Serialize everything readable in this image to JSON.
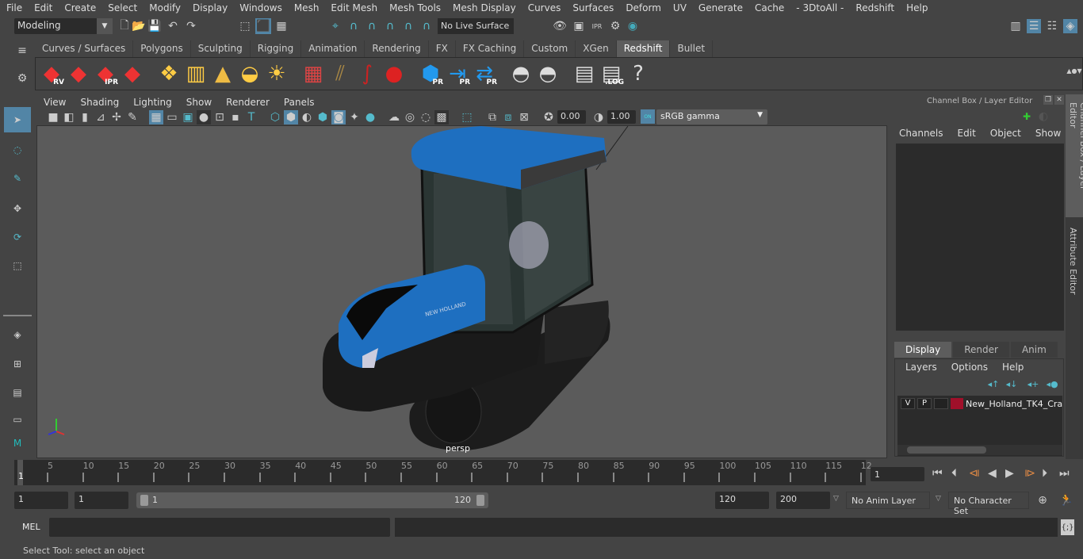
{
  "menu": [
    "File",
    "Edit",
    "Create",
    "Select",
    "Modify",
    "Display",
    "Windows",
    "Mesh",
    "Edit Mesh",
    "Mesh Tools",
    "Mesh Display",
    "Curves",
    "Surfaces",
    "Deform",
    "UV",
    "Generate",
    "Cache",
    "- 3DtoAll -",
    "Redshift",
    "Help"
  ],
  "mode": "Modeling",
  "live_surface": "No Live Surface",
  "shelf_tabs": [
    "Curves / Surfaces",
    "Polygons",
    "Sculpting",
    "Rigging",
    "Animation",
    "Rendering",
    "FX",
    "FX Caching",
    "Custom",
    "XGen",
    "Redshift",
    "Bullet"
  ],
  "active_shelf_tab": "Redshift",
  "shelf_icons": [
    {
      "name": "rv-icon",
      "label": "RV"
    },
    {
      "name": "render-clapper-icon",
      "label": ""
    },
    {
      "name": "ipr-icon",
      "label": "IPR"
    },
    {
      "name": "render-settings-icon",
      "label": ""
    },
    {
      "name": "light-diamond-icon",
      "label": ""
    },
    {
      "name": "area-light-icon",
      "label": ""
    },
    {
      "name": "spot-light-icon",
      "label": ""
    },
    {
      "name": "dome-light-icon",
      "label": ""
    },
    {
      "name": "sun-sky-icon",
      "label": ""
    },
    {
      "name": "volume-icon",
      "label": ""
    },
    {
      "name": "hair-icon",
      "label": ""
    },
    {
      "name": "curve-icon",
      "label": ""
    },
    {
      "name": "material-ball-icon",
      "label": ""
    },
    {
      "name": "proxy-icon",
      "label": "PR"
    },
    {
      "name": "proxy-export-icon",
      "label": "PR"
    },
    {
      "name": "proxy-swap-icon",
      "label": "PR"
    },
    {
      "name": "pie-icon",
      "label": ""
    },
    {
      "name": "pie-single-icon",
      "label": ""
    },
    {
      "name": "script-icon",
      "label": ""
    },
    {
      "name": "log-icon",
      "label": ".LOG"
    },
    {
      "name": "help-icon",
      "label": "?"
    }
  ],
  "viewport": {
    "menu": [
      "View",
      "Shading",
      "Lighting",
      "Show",
      "Renderer",
      "Panels"
    ],
    "exposure": "0.00",
    "gamma": "1.00",
    "color_space": "sRGB gamma",
    "camera_label": "persp",
    "gamma_toggle": "ON"
  },
  "channel_box": {
    "title": "Channel Box / Layer Editor",
    "menu": [
      "Channels",
      "Edit",
      "Object",
      "Show"
    ],
    "layer_tabs": [
      "Display",
      "Render",
      "Anim"
    ],
    "active_layer_tab": "Display",
    "layer_menu": [
      "Layers",
      "Options",
      "Help"
    ],
    "layers": [
      {
        "v": "V",
        "p": "P",
        "color": "#a0102a",
        "name": "New_Holland_TK4_Cra"
      }
    ]
  },
  "side_tabs": [
    "Channel Box / Layer Editor",
    "Attribute Editor"
  ],
  "timeline": {
    "ticks": [
      5,
      10,
      15,
      20,
      25,
      30,
      35,
      40,
      45,
      50,
      55,
      60,
      65,
      70,
      75,
      80,
      85,
      90,
      95,
      100,
      105,
      110,
      115,
      "12"
    ],
    "current_frame_marker": "1",
    "current_frame": "1"
  },
  "range": {
    "start": "1",
    "anim_start": "1",
    "range_start": "1",
    "range_end": "120",
    "end": "120",
    "anim_end": "200",
    "anim_layer": "No Anim Layer",
    "char_set": "No Character Set"
  },
  "mel_label": "MEL",
  "status": "Select Tool: select an object"
}
